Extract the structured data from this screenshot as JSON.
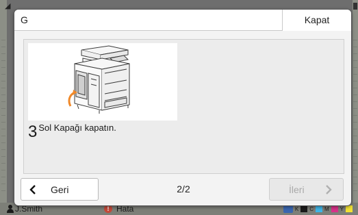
{
  "background": {
    "user_label": "J.Smith",
    "error_label": "Hata",
    "ink_labels": [
      "K",
      "C",
      "M",
      "Y"
    ],
    "ink_colors": [
      "#1a1a1a",
      "#3fb6e8",
      "#d9328a",
      "#f2e234"
    ]
  },
  "dialog": {
    "title": "G",
    "close_label": "Kapat",
    "step_number": "3",
    "step_text": "Sol Kapağı kapatın.",
    "back_label": "Geri",
    "page_indicator": "2/2",
    "next_label": "İleri",
    "next_enabled": false,
    "icons": {
      "back": "chevron-left-icon",
      "next": "chevron-right-icon",
      "illustration": "printer-left-cover-illustration"
    },
    "accent_color": "#f0892a"
  }
}
